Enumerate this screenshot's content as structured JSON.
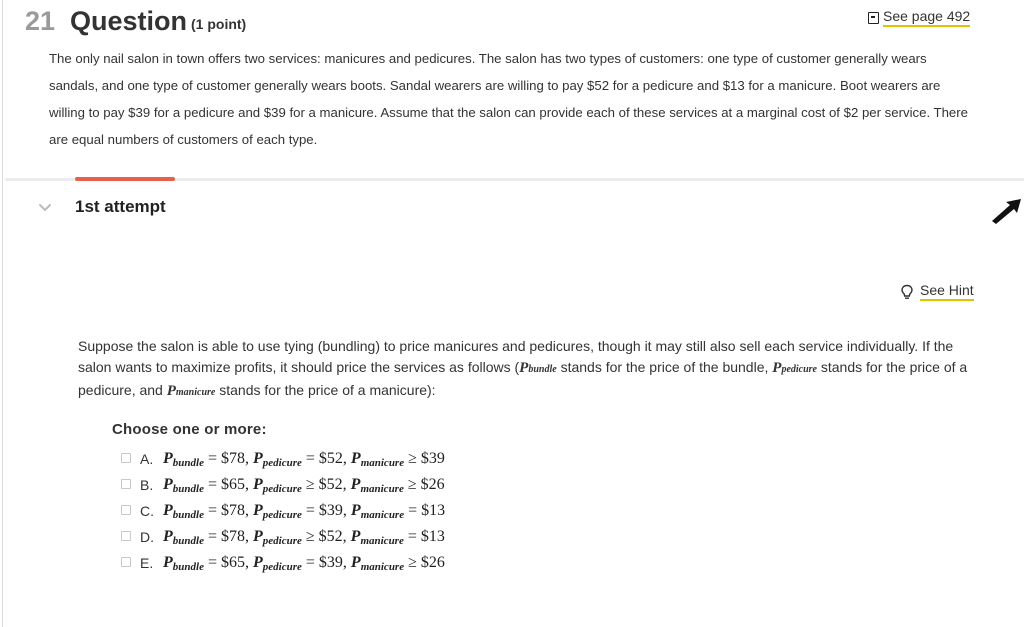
{
  "header": {
    "question_number": "21",
    "question_word": "Question",
    "points": "(1 point)",
    "see_page": "See page 492"
  },
  "question_text": "The only nail salon in town offers two services: manicures and pedicures. The salon has two types of customers: one type of customer generally wears sandals, and one type of customer generally wears boots. Sandal wearers are willing to pay $52 for a pedicure and $13 for a manicure. Boot wearers are willing to pay $39 for a pedicure and $39 for a manicure. Assume that the salon can provide each of these services at a marginal cost of $2 per service. There are equal numbers of customers of each type.",
  "attempt": {
    "title": "1st attempt",
    "see_hint": "See Hint",
    "prompt_part1": "Suppose the salon is able to use tying (bundling) to price manicures and pedicures, though it may still also sell each service individually. If the salon wants to maximize profits, it should price the services as follows (",
    "prompt_part2": " stands for the price of the bundle, ",
    "prompt_part3": " stands for the price of a pedicure, and ",
    "prompt_part4": " stands for the price of a manicure):",
    "var_p": "P",
    "sub_bundle": "bundle",
    "sub_pedicure": "pedicure",
    "sub_manicure": "manicure",
    "choose_label": "Choose one or more:"
  },
  "options": [
    {
      "letter": "A.",
      "bundle": "$78",
      "ped_rel": "=",
      "ped": "$52",
      "man_rel": "≥",
      "man": "$39"
    },
    {
      "letter": "B.",
      "bundle": "$65",
      "ped_rel": "≥",
      "ped": "$52",
      "man_rel": "≥",
      "man": "$26"
    },
    {
      "letter": "C.",
      "bundle": "$78",
      "ped_rel": "=",
      "ped": "$39",
      "man_rel": "=",
      "man": "$13"
    },
    {
      "letter": "D.",
      "bundle": "$78",
      "ped_rel": "≥",
      "ped": "$52",
      "man_rel": "=",
      "man": "$13"
    },
    {
      "letter": "E.",
      "bundle": "$65",
      "ped_rel": "=",
      "ped": "$39",
      "man_rel": "≥",
      "man": "$26"
    }
  ],
  "colors": {
    "accent_bar": "#e8604c",
    "link_underline": "#e0c200",
    "question_number": "#9a9a9a"
  },
  "icons": {
    "see_page": "book-icon",
    "hint": "lightbulb-icon",
    "collapse": "chevron-down-icon",
    "cursor": "mouse-pointer-icon"
  }
}
